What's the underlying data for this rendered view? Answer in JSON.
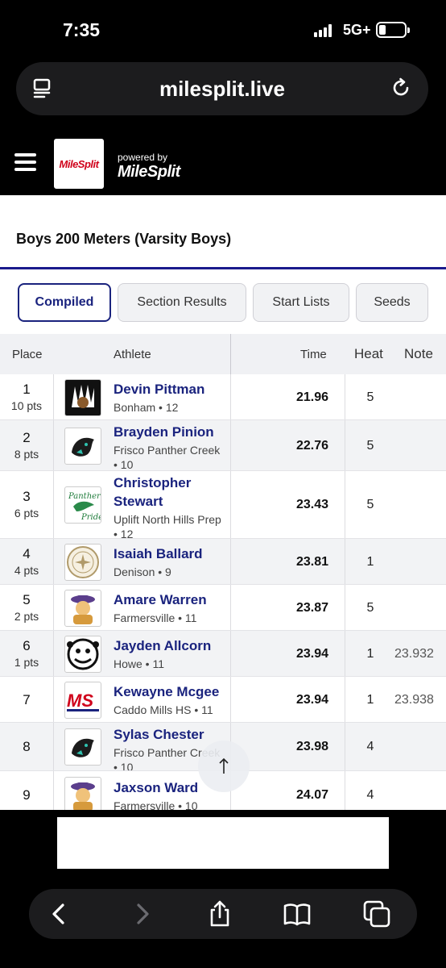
{
  "status": {
    "time": "7:35",
    "network": "5G+"
  },
  "browser": {
    "url": "milesplit.live"
  },
  "site": {
    "logo_text": "MileSplit",
    "powered_by": "powered by",
    "powered_logo": "MileSplit"
  },
  "event": {
    "title": "Boys 200 Meters (Varsity Boys)"
  },
  "tabs": [
    {
      "label": "Compiled",
      "active": true
    },
    {
      "label": "Section Results",
      "active": false
    },
    {
      "label": "Start Lists",
      "active": false
    },
    {
      "label": "Seeds",
      "active": false
    }
  ],
  "table": {
    "headers": {
      "place": "Place",
      "athlete": "Athlete",
      "time": "Time",
      "heat": "Heat",
      "note": "Note"
    },
    "rows": [
      {
        "place": "1",
        "pts": "10 pts",
        "name": "Devin Pittman",
        "team": "Bonham • 12",
        "time": "21.96",
        "heat": "5",
        "note": "",
        "logo": "indian-chief-logo"
      },
      {
        "place": "2",
        "pts": "8 pts",
        "name": "Brayden Pinion",
        "team": "Frisco Panther Creek • 10",
        "time": "22.76",
        "heat": "5",
        "note": "",
        "logo": "panther-logo"
      },
      {
        "place": "3",
        "pts": "6 pts",
        "name": "Christopher Stewart",
        "team": "Uplift North Hills Prep • 12",
        "time": "23.43",
        "heat": "5",
        "note": "",
        "logo": "panther-pride-logo"
      },
      {
        "place": "4",
        "pts": "4 pts",
        "name": "Isaiah Ballard",
        "team": "Denison • 9",
        "time": "23.81",
        "heat": "1",
        "note": "",
        "logo": "denison-seal-logo"
      },
      {
        "place": "5",
        "pts": "2 pts",
        "name": "Amare Warren",
        "team": "Farmersville • 11",
        "time": "23.87",
        "heat": "5",
        "note": "",
        "logo": "farmer-logo"
      },
      {
        "place": "6",
        "pts": "1 pts",
        "name": "Jayden Allcorn",
        "team": "Howe • 11",
        "time": "23.94",
        "heat": "1",
        "note": "23.932",
        "logo": "bulldog-logo"
      },
      {
        "place": "7",
        "pts": "",
        "name": "Kewayne Mcgee",
        "team": "Caddo Mills HS • 11",
        "time": "23.94",
        "heat": "1",
        "note": "23.938",
        "logo": "ms-logo"
      },
      {
        "place": "8",
        "pts": "",
        "name": "Sylas Chester",
        "team": "Frisco Panther Creek • 10",
        "time": "23.98",
        "heat": "4",
        "note": "",
        "logo": "panther-logo"
      },
      {
        "place": "9",
        "pts": "",
        "name": "Jaxson Ward",
        "team": "Farmersville • 10",
        "time": "24.07",
        "heat": "4",
        "note": "",
        "logo": "farmer-logo"
      }
    ]
  },
  "colors": {
    "accent": "#1a237e",
    "rule": "#1a1a8c",
    "brand_red": "#d0021b"
  }
}
